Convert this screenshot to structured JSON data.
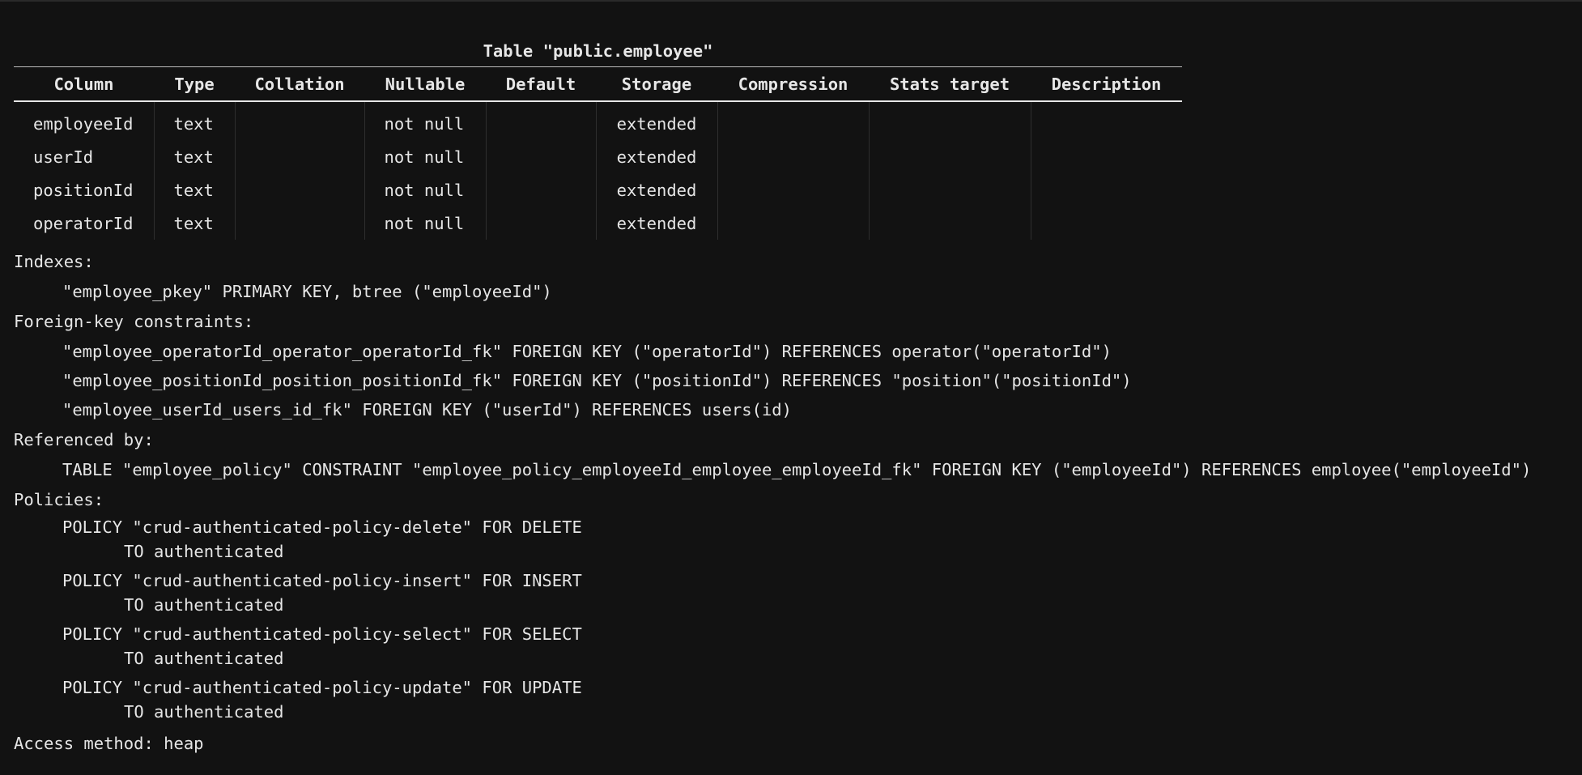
{
  "table": {
    "caption": "Table \"public.employee\"",
    "columns": [
      "Column",
      "Type",
      "Collation",
      "Nullable",
      "Default",
      "Storage",
      "Compression",
      "Stats target",
      "Description"
    ],
    "rows": [
      [
        "employeeId",
        "text",
        "",
        "not null",
        "",
        "extended",
        "",
        "",
        ""
      ],
      [
        "userId",
        "text",
        "",
        "not null",
        "",
        "extended",
        "",
        "",
        ""
      ],
      [
        "positionId",
        "text",
        "",
        "not null",
        "",
        "extended",
        "",
        "",
        ""
      ],
      [
        "operatorId",
        "text",
        "",
        "not null",
        "",
        "extended",
        "",
        "",
        ""
      ]
    ]
  },
  "indexes": {
    "title": "Indexes:",
    "items": [
      "\"employee_pkey\" PRIMARY KEY, btree (\"employeeId\")"
    ]
  },
  "foreign_keys": {
    "title": "Foreign-key constraints:",
    "items": [
      "\"employee_operatorId_operator_operatorId_fk\" FOREIGN KEY (\"operatorId\") REFERENCES operator(\"operatorId\")",
      "\"employee_positionId_position_positionId_fk\" FOREIGN KEY (\"positionId\") REFERENCES \"position\"(\"positionId\")",
      "\"employee_userId_users_id_fk\" FOREIGN KEY (\"userId\") REFERENCES users(id)"
    ]
  },
  "referenced_by": {
    "title": "Referenced by:",
    "items": [
      "TABLE \"employee_policy\" CONSTRAINT \"employee_policy_employeeId_employee_employeeId_fk\" FOREIGN KEY (\"employeeId\") REFERENCES employee(\"employeeId\")"
    ]
  },
  "policies": {
    "title": "Policies:",
    "items": [
      {
        "line1": "POLICY \"crud-authenticated-policy-delete\" FOR DELETE",
        "line2": "TO authenticated"
      },
      {
        "line1": "POLICY \"crud-authenticated-policy-insert\" FOR INSERT",
        "line2": "TO authenticated"
      },
      {
        "line1": "POLICY \"crud-authenticated-policy-select\" FOR SELECT",
        "line2": "TO authenticated"
      },
      {
        "line1": "POLICY \"crud-authenticated-policy-update\" FOR UPDATE",
        "line2": "TO authenticated"
      }
    ]
  },
  "access_method": "Access method: heap"
}
